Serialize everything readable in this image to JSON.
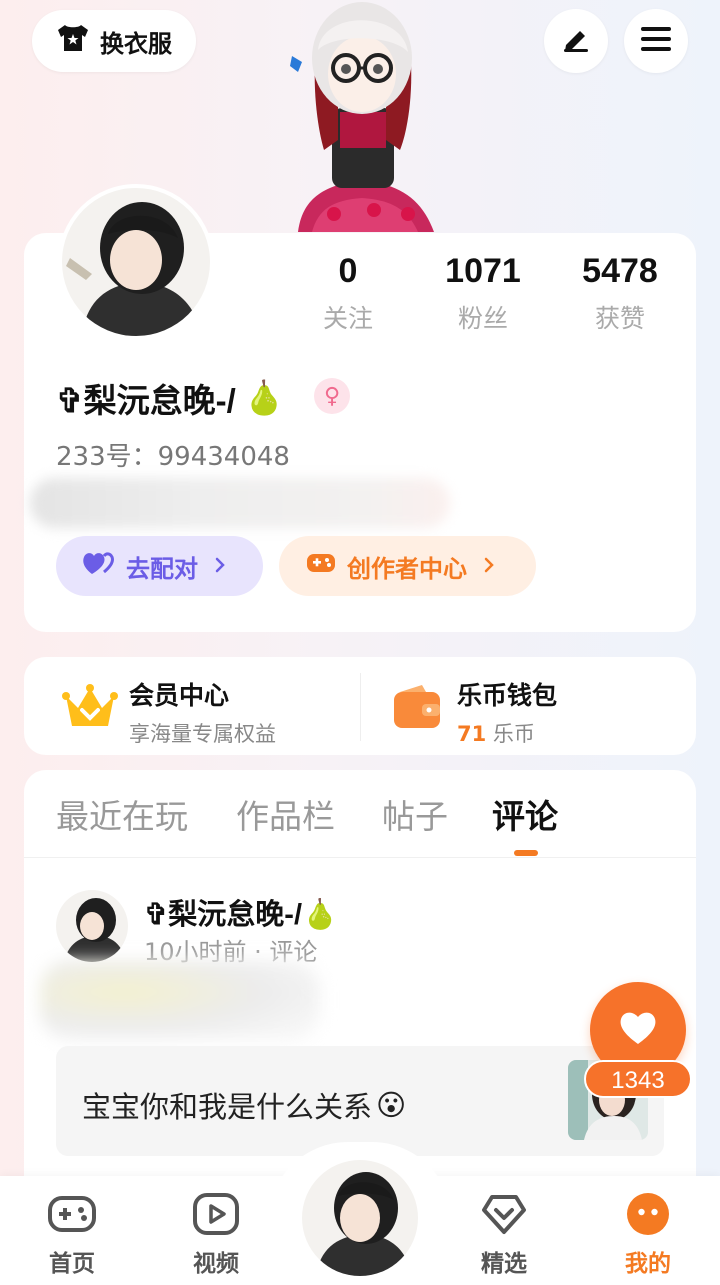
{
  "header": {
    "dress_label": "换衣服",
    "edit_icon": "pen-icon",
    "menu_icon": "hamburger-menu-icon"
  },
  "profile": {
    "stats": [
      {
        "value": "0",
        "label": "关注"
      },
      {
        "value": "1071",
        "label": "粉丝"
      },
      {
        "value": "5478",
        "label": "获赞"
      }
    ],
    "username": "✞梨沅怠晚-/",
    "username_emoji": "🍐",
    "uid": "233号：99434048",
    "buttons": {
      "match": "去配对",
      "creator": "创作者中心"
    }
  },
  "vip": {
    "member": {
      "title": "会员中心",
      "subtitle": "享海量专属权益"
    },
    "wallet": {
      "title": "乐币钱包",
      "amount": "71",
      "unit": "乐币"
    }
  },
  "tabs": [
    "最近在玩",
    "作品栏",
    "帖子",
    "评论"
  ],
  "active_tab": "评论",
  "comment": {
    "author": "✞梨沅怠晚-/",
    "author_emoji": "🍐",
    "meta": "10小时前 · 评论",
    "reply_text": "宝宝你和我是什么关系",
    "reply_emoji": "😮",
    "likes": "1343"
  },
  "nav": [
    {
      "label": "首页",
      "icon": "gamepad-icon"
    },
    {
      "label": "视频",
      "icon": "video-play-icon"
    },
    {
      "label": "精选",
      "icon": "heart-diamond-icon"
    },
    {
      "label": "我的",
      "icon": "profile-face-icon"
    }
  ],
  "colors": {
    "accent": "#f47a22",
    "match_purple": "#6b5de6",
    "card": "#ffffff"
  }
}
